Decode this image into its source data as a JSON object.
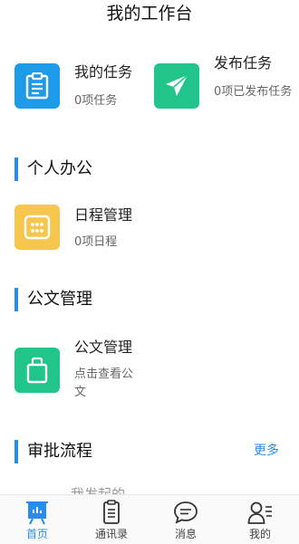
{
  "header": {
    "title": "我的工作台"
  },
  "quick": [
    {
      "title": "我的任务",
      "sub": "0项任务",
      "icon": "clipboard-icon",
      "color": "#1e9be8"
    },
    {
      "title": "发布任务",
      "sub": "0项已发布任务",
      "icon": "paper-plane-icon",
      "color": "#21c48a"
    }
  ],
  "sections": {
    "personal": {
      "label": "个人办公"
    },
    "documents": {
      "label": "公文管理"
    },
    "approval": {
      "label": "审批流程",
      "more": "更多"
    }
  },
  "schedule": {
    "title": "日程管理",
    "sub": "0项日程",
    "icon": "calendar-icon",
    "color": "#f7c64c"
  },
  "docs": {
    "title": "公文管理",
    "sub": "点击查看公文",
    "icon": "bag-icon",
    "color": "#21c48a"
  },
  "approval_peek": "我发起的",
  "tabs": [
    {
      "label": "首页",
      "icon": "home-chart-icon",
      "active": true
    },
    {
      "label": "通讯录",
      "icon": "contacts-list-icon",
      "active": false
    },
    {
      "label": "消息",
      "icon": "chat-bubble-icon",
      "active": false
    },
    {
      "label": "我的",
      "icon": "profile-icon",
      "active": false
    }
  ],
  "colors": {
    "accent": "#2a8ce8",
    "blue_tile": "#1e9be8",
    "green_tile": "#21c48a",
    "yellow_tile": "#f7c64c"
  }
}
